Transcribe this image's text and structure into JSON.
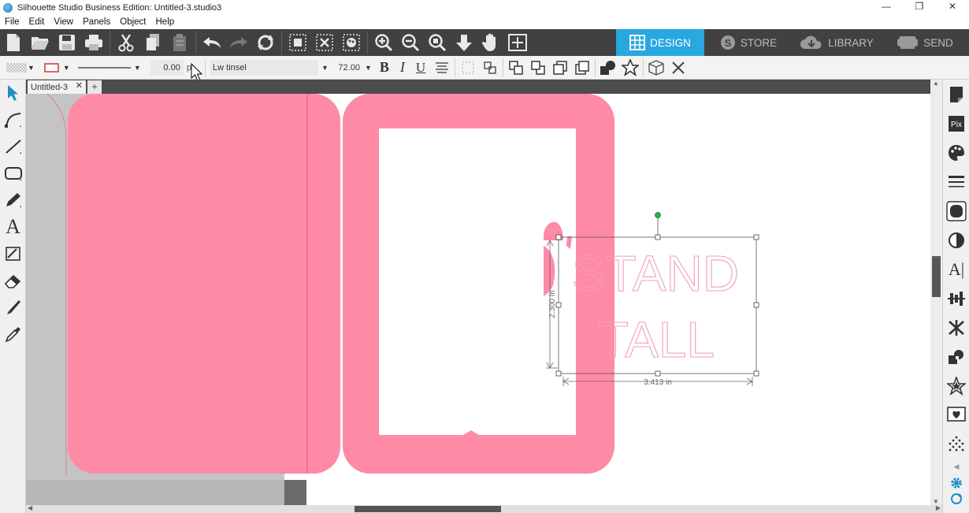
{
  "window": {
    "title": "Silhouette Studio Business Edition: Untitled-3.studio3",
    "controls": [
      "—",
      "❐",
      "✕"
    ]
  },
  "menu": [
    "File",
    "Edit",
    "View",
    "Panels",
    "Object",
    "Help"
  ],
  "nav_tabs": [
    {
      "label": "DESIGN",
      "active": true
    },
    {
      "label": "STORE",
      "active": false
    },
    {
      "label": "LIBRARY",
      "active": false
    },
    {
      "label": "SEND",
      "active": false
    }
  ],
  "props": {
    "line_width_value": "0.00",
    "line_width_unit": "pt",
    "font_name": "Lw tinsel",
    "font_size": "72.00",
    "bold": "B",
    "italic": "I",
    "underline": "U"
  },
  "doc_tab": {
    "name": "Untitled-3",
    "close": "✕",
    "add": "+"
  },
  "design": {
    "text_line1": "STAND",
    "text_line2": "TALL",
    "width_label": "3.413 in",
    "height_label": "2.300 in",
    "card_color": "#ff8aa6",
    "text_outline_color": "#f1a0b1"
  },
  "colors": {
    "accent": "#29a7df",
    "toolbar_dark": "#414141"
  }
}
